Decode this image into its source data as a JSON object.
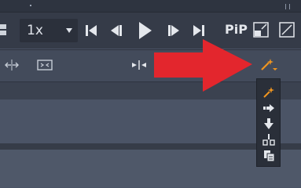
{
  "transport": {
    "speed_value": "1x",
    "speed_icon": "chevron-down-icon",
    "buttons": [
      "skip-to-start-icon",
      "step-back-icon",
      "play-icon",
      "step-forward-icon",
      "skip-to-end-icon"
    ],
    "pip_label": "PiP",
    "minimize_icon": "minimize-icon",
    "fullscreen_icon": "fullscreen-icon"
  },
  "toolbar": {
    "split_icon": "split-arrows-icon",
    "fit_icon": "fit-frame-icon",
    "snap_icon": "snap-icon",
    "magic_tool_icon": "magic-wand-icon",
    "accent_color": "#f0951f",
    "callout_color": "#e3262d"
  },
  "magic_menu": {
    "items": [
      "magic-wand-icon",
      "insert-arrow-icon",
      "down-arrow-icon",
      "ripple-icon",
      "document-icon"
    ]
  }
}
